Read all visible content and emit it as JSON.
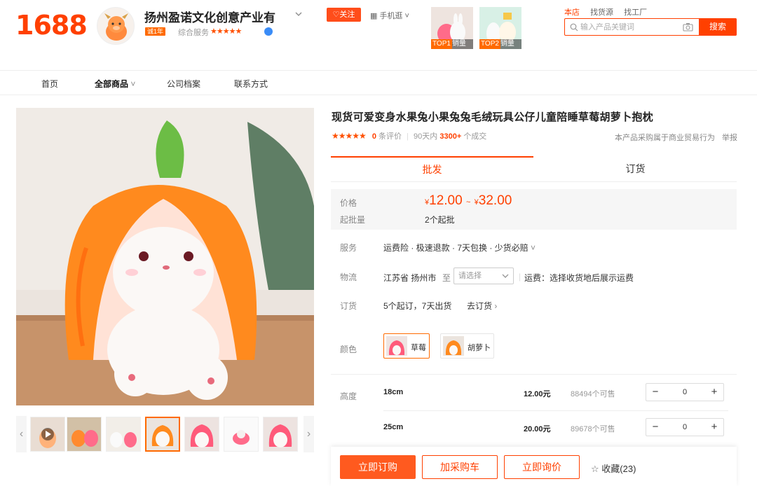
{
  "header": {
    "logo": "1688",
    "shop_name": "扬州盈诺文化创意产业有",
    "shop_badge_year": "诚1年",
    "shop_service_label": "综合服务",
    "shop_stars": "★★★★★",
    "follow_label": "♡关注",
    "mobile_shop_label": "手机逛",
    "top_items": [
      {
        "rank": "TOP1",
        "label": "销量"
      },
      {
        "rank": "TOP2",
        "label": "销量"
      }
    ],
    "search_tabs": [
      "本店",
      "找货源",
      "找工厂"
    ],
    "search_placeholder": "输入产品关键词",
    "search_button": "搜索"
  },
  "nav": {
    "items": [
      "首页",
      "全部商品",
      "公司档案",
      "联系方式"
    ]
  },
  "product": {
    "title": "现货可爱变身水果兔小果兔兔毛绒玩具公仔儿童陪睡草莓胡萝卜抱枕",
    "rating_stars": "★★★★★",
    "review_count": "0",
    "review_label": "条评价",
    "days_label": "90天内",
    "deal_count": "3300+",
    "deal_label": "个成交",
    "trade_note": "本产品采购属于商业贸易行为",
    "report": "举报",
    "tabs": [
      "批发",
      "订货"
    ],
    "price_label": "价格",
    "currency": "¥",
    "price_min": "12.00",
    "price_sep": "~",
    "price_max": "32.00",
    "moq_label": "起批量",
    "moq_value": "2个起批",
    "service_label": "服务",
    "service_value": "运费险 · 极速退款 · 7天包换 · 少货必赔",
    "logistics_label": "物流",
    "origin": "江苏省 扬州市",
    "to_label": "至",
    "select_placeholder": "请选择",
    "freight_text": "运费：选择收货地后展示运费",
    "order_label": "订货",
    "order_terms": "5个起订，7天出货",
    "order_link": "去订货",
    "color_label": "颜色",
    "colors": [
      {
        "name": "草莓",
        "active": true
      },
      {
        "name": "胡萝卜",
        "active": false
      }
    ],
    "height_label": "高度",
    "sizes": [
      {
        "size": "18cm",
        "price": "12.00元",
        "stock": "88494个可售",
        "qty": "0"
      },
      {
        "size": "25cm",
        "price": "20.00元",
        "stock": "89678个可售",
        "qty": "0"
      }
    ],
    "stepper_minus": "−",
    "stepper_plus": "+"
  },
  "actions": {
    "buy_now": "立即订购",
    "add_cart": "加采购车",
    "inquire": "立即询价",
    "favorite": "收藏(23)"
  },
  "colors": {
    "brand": "#ff4000",
    "accent": "#ff6a00"
  }
}
